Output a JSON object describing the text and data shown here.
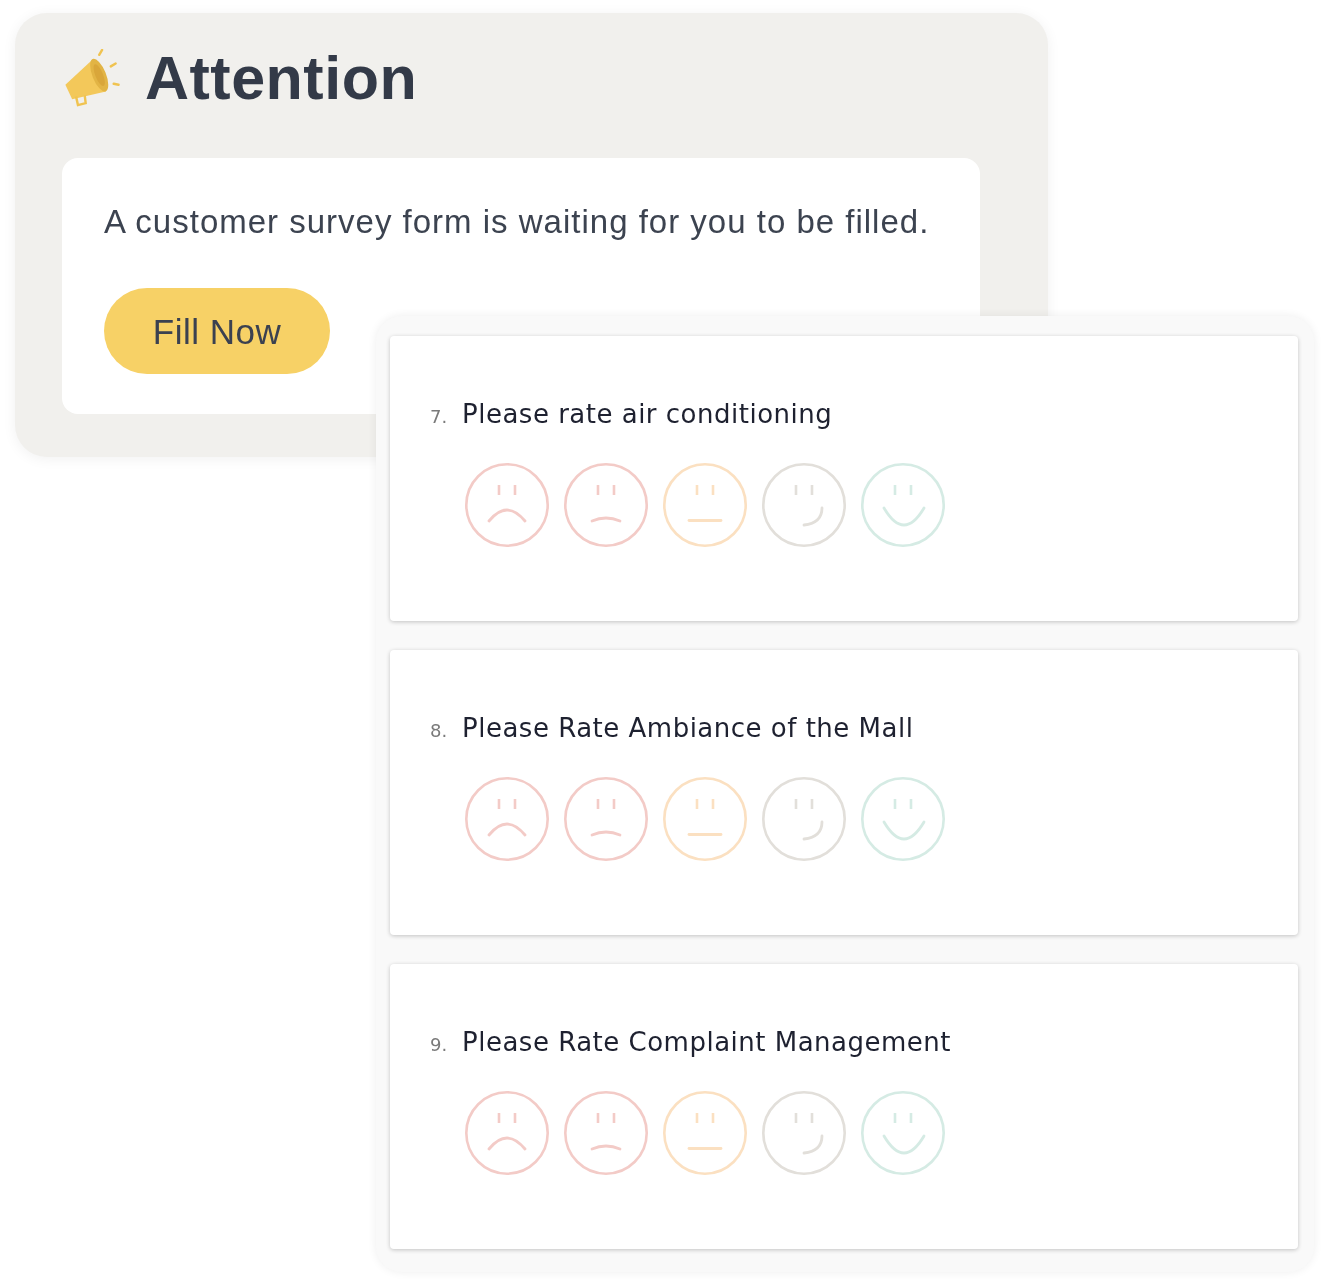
{
  "notice": {
    "title": "Attention",
    "message": "A customer survey form is waiting for you to be filled.",
    "button": "Fill Now"
  },
  "questions": [
    {
      "number": "7.",
      "text": "Please rate air conditioning",
      "options": [
        {
          "kind": "frown",
          "color": "#f3cbc7",
          "selected": false
        },
        {
          "kind": "slight_frown",
          "color": "#f3cbc7",
          "selected": false
        },
        {
          "kind": "neutral",
          "color": "#fbe0c1",
          "selected": false
        },
        {
          "kind": "slight_smile",
          "color": "#e2dfda",
          "selected": false
        },
        {
          "kind": "smile",
          "color": "#d5ebe4",
          "selected": false
        }
      ]
    },
    {
      "number": "8.",
      "text": "Please Rate Ambiance of the Mall",
      "options": [
        {
          "kind": "frown",
          "color": "#f3cbc7",
          "selected": false
        },
        {
          "kind": "slight_frown",
          "color": "#f3cbc7",
          "selected": false
        },
        {
          "kind": "neutral",
          "color": "#fbe0c1",
          "selected": false
        },
        {
          "kind": "slight_smile",
          "color": "#e2dfda",
          "selected": false
        },
        {
          "kind": "smile",
          "color": "#d5ebe4",
          "selected": false
        }
      ]
    },
    {
      "number": "9.",
      "text": "Please Rate Complaint Management",
      "options": [
        {
          "kind": "frown",
          "color": "#f3cbc7",
          "selected": false
        },
        {
          "kind": "slight_frown",
          "color": "#f3cbc7",
          "selected": false
        },
        {
          "kind": "neutral",
          "color": "#fbe0c1",
          "selected": false
        },
        {
          "kind": "slight_smile",
          "color": "#e2dfda",
          "selected": false
        },
        {
          "kind": "smile",
          "color": "#d5ebe4",
          "selected": false
        }
      ]
    }
  ]
}
